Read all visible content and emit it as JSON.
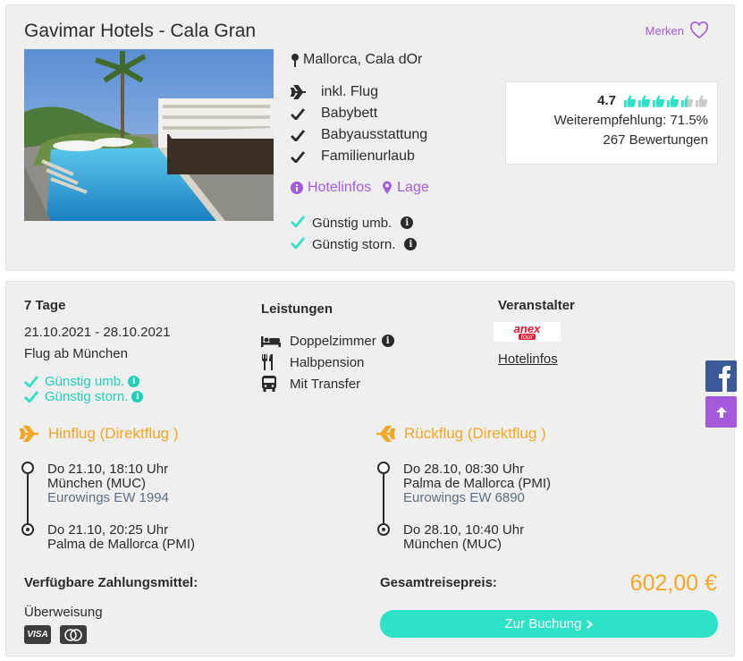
{
  "hotel": {
    "name": "Gavimar Hotels - Cala Gran",
    "merken_label": "Merken",
    "location": "Mallorca, Cala dOr",
    "features": [
      "inkl. Flug",
      "Babybett",
      "Babyausstattung",
      "Familienurlaub"
    ],
    "links": {
      "hotelinfos": "Hotelinfos",
      "lage": "Lage"
    },
    "conditions": [
      "Günstig umb.",
      "Günstig storn."
    ],
    "rating": {
      "score": "4.7",
      "thumbs_filled": 4.5,
      "thumbs_total": 6,
      "recommendation": "Weiterempfehlung: 71.5%",
      "reviews": "267 Bewertungen"
    },
    "colors": {
      "accent": "#a45bdb",
      "teal": "#2de2c7",
      "orange": "#f5a623"
    }
  },
  "offer": {
    "duration": "7 Tage",
    "dates": "21.10.2021 - 28.10.2021",
    "departure_from": "Flug ab München",
    "conditions": [
      "Günstig umb.",
      "Günstig storn."
    ],
    "services_title": "Leistungen",
    "services": [
      {
        "icon": "bed-icon",
        "label": "Doppelzimmer"
      },
      {
        "icon": "cutlery-icon",
        "label": "Halbpension"
      },
      {
        "icon": "bus-icon",
        "label": "Mit Transfer"
      }
    ],
    "organizer_title": "Veranstalter",
    "organizer_logo": {
      "line1": "anex",
      "line2": "tour"
    },
    "organizer_link": "Hotelinfos",
    "outbound": {
      "title": "Hinflug (Direktflug )",
      "dep_time": "Do 21.10, 18:10 Uhr",
      "dep_airport": "München (MUC)",
      "airline": "Eurowings EW 1994",
      "arr_time": "Do 21.10, 20:25 Uhr",
      "arr_airport": "Palma de Mallorca (PMI)"
    },
    "return": {
      "title": "Rückflug (Direktflug )",
      "dep_time": "Do 28.10, 08:30 Uhr",
      "dep_airport": "Palma de Mallorca (PMI)",
      "airline": "Eurowings EW 6890",
      "arr_time": "Do 28.10, 10:40 Uhr",
      "arr_airport": "München (MUC)"
    },
    "payment_title": "Verfügbare Zahlungsmittel:",
    "payment_method": "Überweisung",
    "card_visa": "VISA",
    "total_title": "Gesamtreisepreis:",
    "price": "602,00 €",
    "book_label": "Zur Buchung"
  },
  "side": {
    "facebook_icon": "facebook-icon",
    "scroll_top_icon": "arrow-up-icon"
  }
}
